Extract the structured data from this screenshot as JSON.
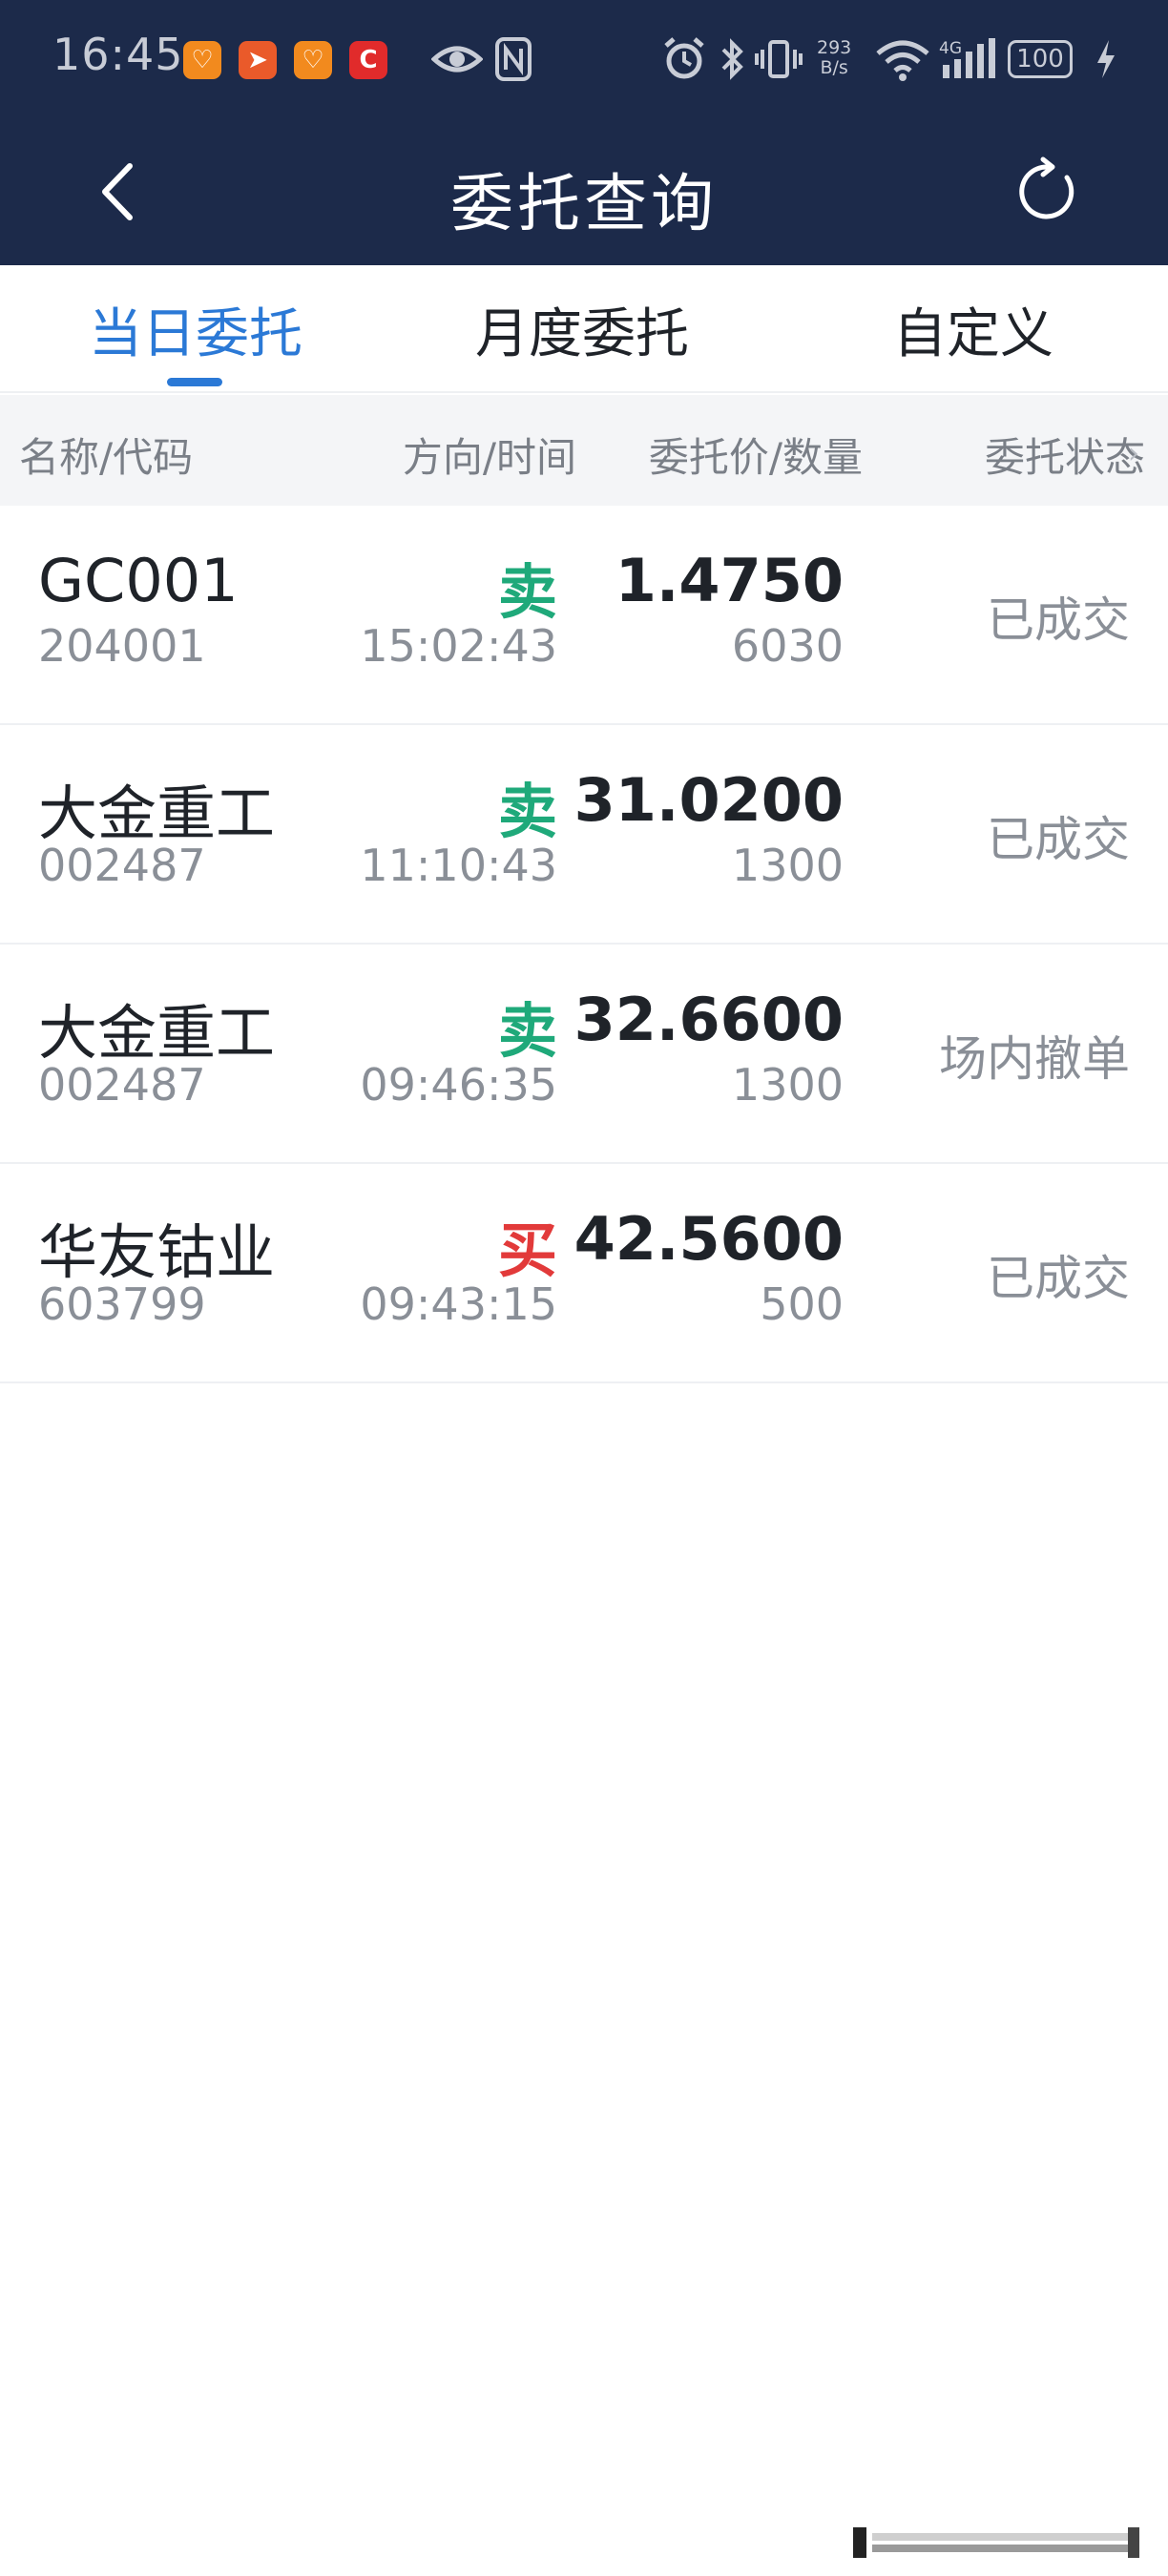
{
  "status_bar": {
    "time": "16:45",
    "net_speed_value": "293",
    "net_speed_unit": "B/s",
    "network_label": "4G",
    "battery": "100",
    "notification_icons": [
      {
        "name": "app-orange-heart-icon",
        "color": "#f28a1e",
        "glyph": "♡"
      },
      {
        "name": "app-red-send-icon",
        "color": "#ea5a2a",
        "glyph": "➤"
      },
      {
        "name": "app-orange-heart-icon-2",
        "color": "#f28a1e",
        "glyph": "♡"
      },
      {
        "name": "app-red-c-icon",
        "color": "#e12b2b",
        "glyph": "C"
      }
    ]
  },
  "nav": {
    "title": "委托查询",
    "back_icon": "chevron-left-icon",
    "refresh_icon": "refresh-icon"
  },
  "tabs": [
    {
      "label": "当日委托",
      "active": true
    },
    {
      "label": "月度委托",
      "active": false
    },
    {
      "label": "自定义",
      "active": false
    }
  ],
  "columns": {
    "name_code": "名称/代码",
    "direction_time": "方向/时间",
    "price_quantity": "委托价/数量",
    "status": "委托状态"
  },
  "orders": [
    {
      "name": "GC001",
      "code": "204001",
      "direction": "卖",
      "side": "sell",
      "time": "15:02:43",
      "price": "1.4750",
      "quantity": "6030",
      "status": "已成交"
    },
    {
      "name": "大金重工",
      "code": "002487",
      "direction": "卖",
      "side": "sell",
      "time": "11:10:43",
      "price": "31.0200",
      "quantity": "1300",
      "status": "已成交"
    },
    {
      "name": "大金重工",
      "code": "002487",
      "direction": "卖",
      "side": "sell",
      "time": "09:46:35",
      "price": "32.6600",
      "quantity": "1300",
      "status": "场内撤单"
    },
    {
      "name": "华友钴业",
      "code": "603799",
      "direction": "买",
      "side": "buy",
      "time": "09:43:15",
      "price": "42.5600",
      "quantity": "500",
      "status": "已成交"
    }
  ],
  "colors": {
    "header_bg": "#1c2a4a",
    "accent_blue": "#2b79d6",
    "sell_green": "#1fa97a",
    "buy_red": "#e23a3a"
  }
}
